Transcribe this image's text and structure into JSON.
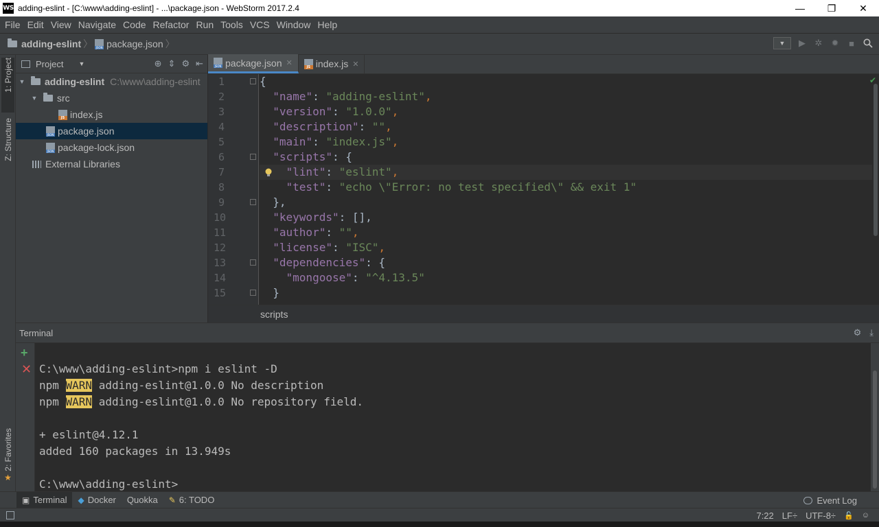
{
  "window": {
    "title": "adding-eslint - [C:\\www\\adding-eslint] - ...\\package.json - WebStorm 2017.2.4",
    "logo": "WS",
    "minimize": "—",
    "maximize": "❐",
    "close": "✕"
  },
  "menu": [
    "File",
    "Edit",
    "View",
    "Navigate",
    "Code",
    "Refactor",
    "Run",
    "Tools",
    "VCS",
    "Window",
    "Help"
  ],
  "navbar": {
    "project": "adding-eslint",
    "file": "package.json",
    "separator": "〉"
  },
  "left_strip": {
    "project_tab": "1: Project",
    "structure_tab": "Z: Structure",
    "favorites_tab": "2: Favorites"
  },
  "project_panel": {
    "title": "Project",
    "tree": [
      {
        "label": "adding-eslint",
        "path": "C:\\www\\adding-eslint",
        "type": "folder",
        "expanded": true
      },
      {
        "label": "src",
        "type": "folder",
        "expanded": true
      },
      {
        "label": "index.js",
        "type": "js"
      },
      {
        "label": "package.json",
        "type": "json",
        "selected": true
      },
      {
        "label": "package-lock.json",
        "type": "json"
      },
      {
        "label": "External Libraries",
        "type": "library"
      }
    ]
  },
  "editor": {
    "tabs": [
      {
        "label": "package.json",
        "active": true
      },
      {
        "label": "index.js",
        "active": false
      }
    ],
    "line_numbers": [
      "1",
      "2",
      "3",
      "4",
      "5",
      "6",
      "7",
      "8",
      "9",
      "10",
      "11",
      "12",
      "13",
      "14",
      "15"
    ],
    "breadcrumb": "scripts",
    "lines": [
      [
        {
          "t": "{",
          "c": ""
        }
      ],
      [
        {
          "t": "  ",
          "c": ""
        },
        {
          "t": "\"name\"",
          "c": "k"
        },
        {
          "t": ": ",
          "c": ""
        },
        {
          "t": "\"adding-eslint\"",
          "c": "s"
        },
        {
          "t": ",",
          "c": "p"
        }
      ],
      [
        {
          "t": "  ",
          "c": ""
        },
        {
          "t": "\"version\"",
          "c": "k"
        },
        {
          "t": ": ",
          "c": ""
        },
        {
          "t": "\"1.0.0\"",
          "c": "s"
        },
        {
          "t": ",",
          "c": "p"
        }
      ],
      [
        {
          "t": "  ",
          "c": ""
        },
        {
          "t": "\"description\"",
          "c": "k"
        },
        {
          "t": ": ",
          "c": ""
        },
        {
          "t": "\"\"",
          "c": "s"
        },
        {
          "t": ",",
          "c": "p"
        }
      ],
      [
        {
          "t": "  ",
          "c": ""
        },
        {
          "t": "\"main\"",
          "c": "k"
        },
        {
          "t": ": ",
          "c": ""
        },
        {
          "t": "\"index.js\"",
          "c": "s"
        },
        {
          "t": ",",
          "c": "p"
        }
      ],
      [
        {
          "t": "  ",
          "c": ""
        },
        {
          "t": "\"scripts\"",
          "c": "k"
        },
        {
          "t": ": {",
          "c": ""
        }
      ],
      [
        {
          "t": "    ",
          "c": ""
        },
        {
          "t": "\"lint\"",
          "c": "k"
        },
        {
          "t": ": ",
          "c": ""
        },
        {
          "t": "\"eslint\"",
          "c": "s"
        },
        {
          "t": ",",
          "c": "p"
        }
      ],
      [
        {
          "t": "    ",
          "c": ""
        },
        {
          "t": "\"test\"",
          "c": "k"
        },
        {
          "t": ": ",
          "c": ""
        },
        {
          "t": "\"echo \\\"Error: no test specified\\\" && exit 1\"",
          "c": "s"
        }
      ],
      [
        {
          "t": "  },",
          "c": ""
        }
      ],
      [
        {
          "t": "  ",
          "c": ""
        },
        {
          "t": "\"keywords\"",
          "c": "k"
        },
        {
          "t": ": [],",
          "c": ""
        }
      ],
      [
        {
          "t": "  ",
          "c": ""
        },
        {
          "t": "\"author\"",
          "c": "k"
        },
        {
          "t": ": ",
          "c": ""
        },
        {
          "t": "\"\"",
          "c": "s"
        },
        {
          "t": ",",
          "c": "p"
        }
      ],
      [
        {
          "t": "  ",
          "c": ""
        },
        {
          "t": "\"license\"",
          "c": "k"
        },
        {
          "t": ": ",
          "c": ""
        },
        {
          "t": "\"ISC\"",
          "c": "s"
        },
        {
          "t": ",",
          "c": "p"
        }
      ],
      [
        {
          "t": "  ",
          "c": ""
        },
        {
          "t": "\"dependencies\"",
          "c": "k"
        },
        {
          "t": ": {",
          "c": ""
        }
      ],
      [
        {
          "t": "    ",
          "c": ""
        },
        {
          "t": "\"mongoose\"",
          "c": "k"
        },
        {
          "t": ": ",
          "c": ""
        },
        {
          "t": "\"^4.13.5\"",
          "c": "s"
        }
      ],
      [
        {
          "t": "  }",
          "c": ""
        }
      ]
    ]
  },
  "terminal": {
    "title": "Terminal",
    "prompt_line": "C:\\www\\adding-eslint>npm i eslint -D",
    "warn_prefix": "npm ",
    "warn_tag": "WARN",
    "warn1_rest": " adding-eslint@1.0.0 No description",
    "warn2_rest": " adding-eslint@1.0.0 No repository field.",
    "installed": "+ eslint@4.12.1",
    "added": "added 160 packages in 13.949s",
    "final_prompt": "C:\\www\\adding-eslint>"
  },
  "bottom_tabs": [
    {
      "label": "Terminal",
      "icon": "terminal-icon",
      "active": true
    },
    {
      "label": "Docker",
      "icon": "docker-icon",
      "active": false
    },
    {
      "label": "Quokka",
      "icon": "",
      "active": false
    },
    {
      "label": "6: TODO",
      "icon": "todo-icon",
      "active": false
    }
  ],
  "event_log": "Event Log",
  "status": {
    "position": "7:22",
    "line_sep": "LF÷",
    "encoding": "UTF-8÷"
  },
  "colors": {
    "key": "#9876aa",
    "string": "#6a8759",
    "punct": "#cc7832",
    "warn_bg": "#e6c65c",
    "selection": "#0d293e"
  }
}
